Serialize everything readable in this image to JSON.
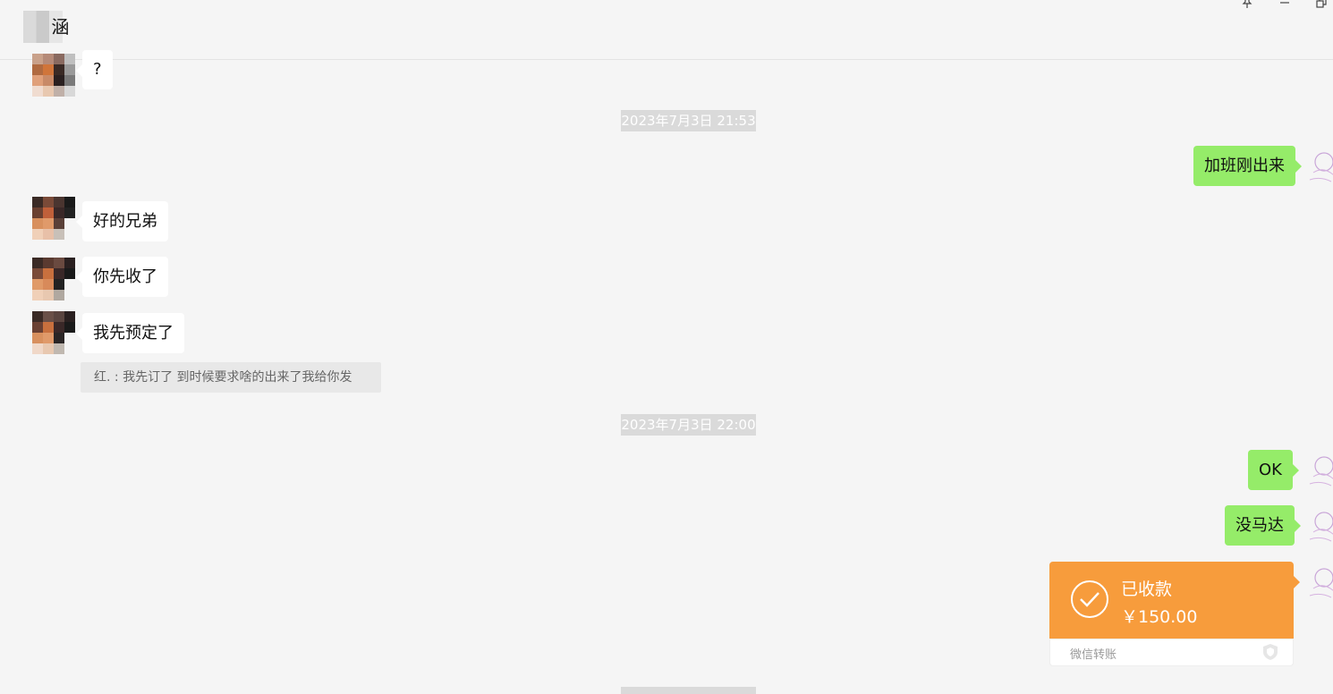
{
  "header": {
    "title": "    涵",
    "pin_icon": "pin-icon",
    "minimize_icon": "minimize-icon",
    "restore_icon": "restore-icon"
  },
  "messages": {
    "q": "?",
    "time1": "2023年7月3日 21:53",
    "out1": "加班刚出来",
    "in1": "好的兄弟",
    "in2": "你先收了",
    "in3": "我先预定了",
    "quote": "红. : 我先订了 到时候要求啥的出来了我给你发",
    "time2": "2023年7月3日 22:00",
    "out2": "OK",
    "out3": "没马达"
  },
  "transfer": {
    "status": "已收款",
    "amount": "￥150.00",
    "label": "微信转账",
    "accent": "#f79c3c"
  },
  "colors": {
    "my_bubble": "#95ec69",
    "their_bubble": "#ffffff",
    "background": "#f5f5f5"
  }
}
